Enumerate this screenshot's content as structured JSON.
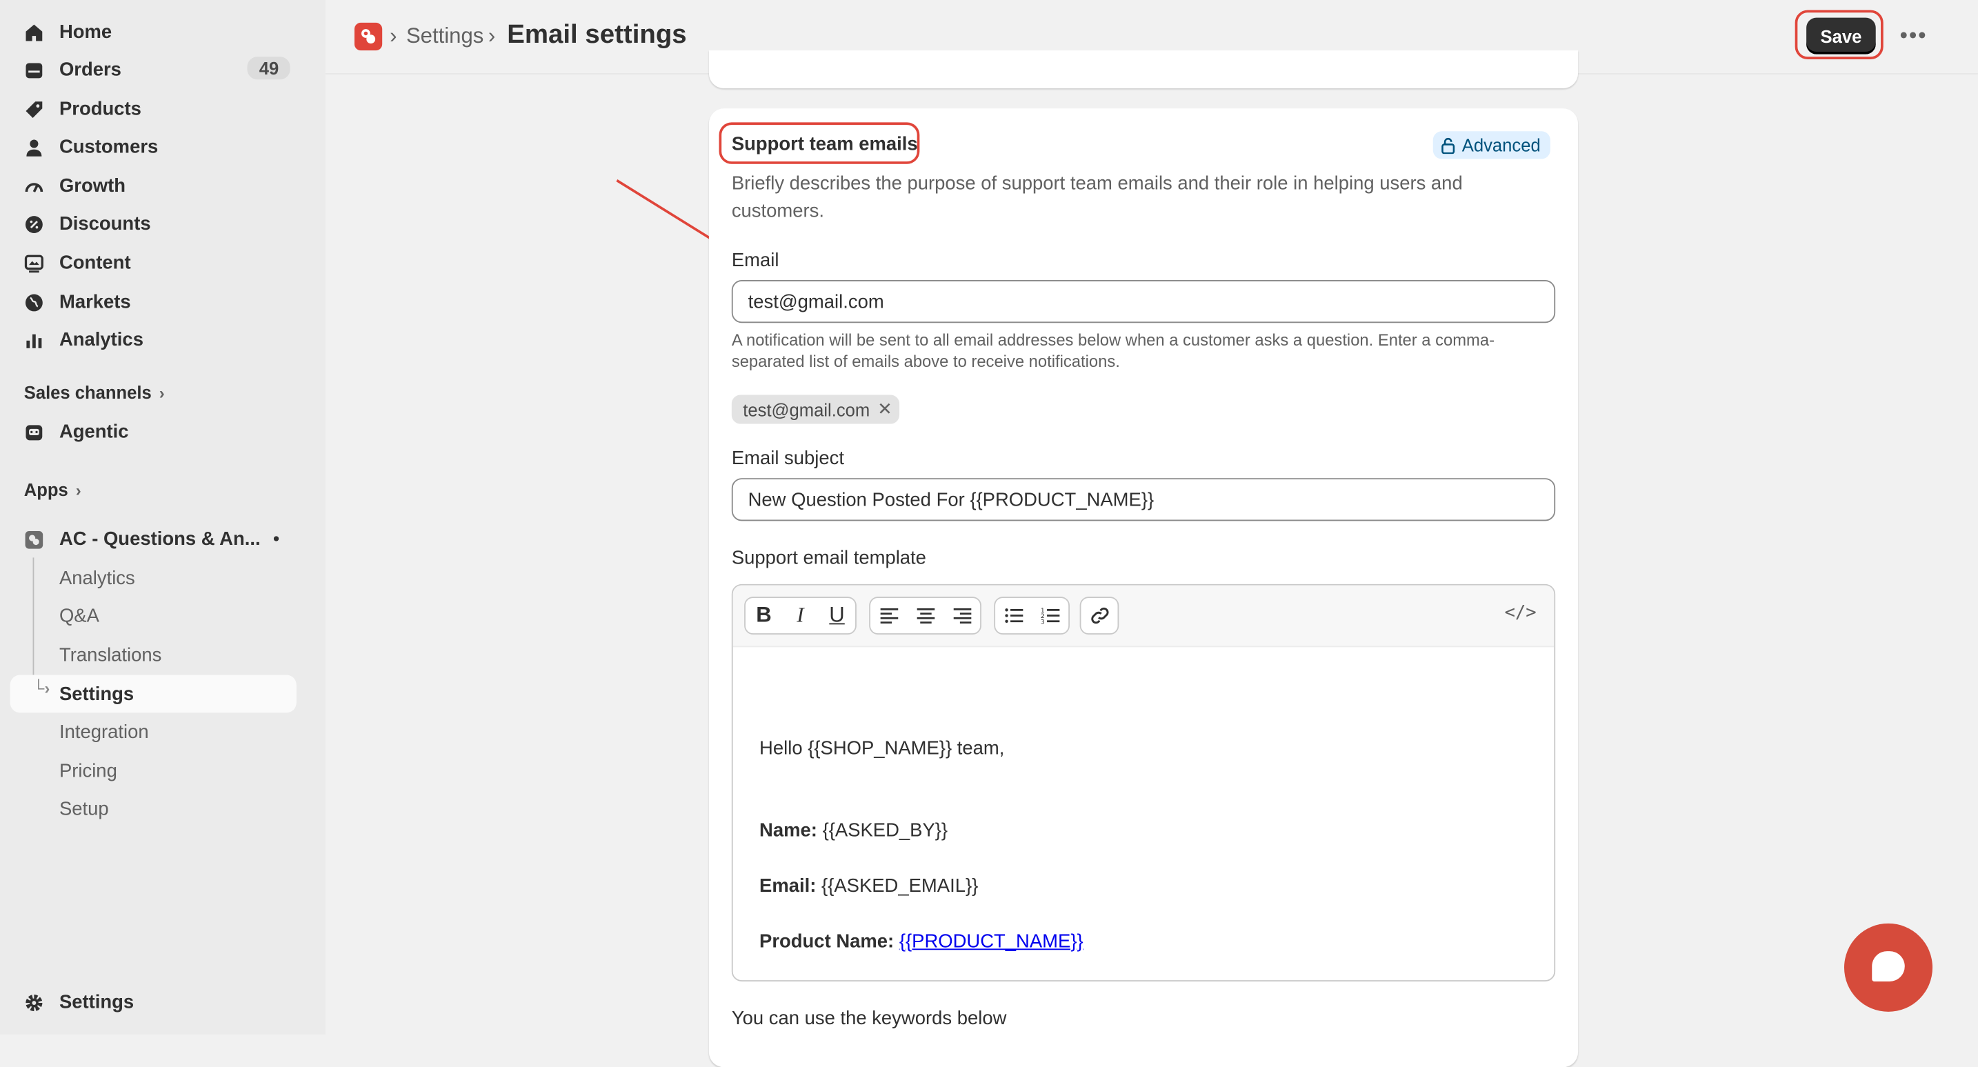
{
  "sidebar": {
    "items": [
      {
        "label": "Home",
        "icon": "home-icon"
      },
      {
        "label": "Orders",
        "icon": "orders-icon",
        "badge": "49"
      },
      {
        "label": "Products",
        "icon": "tag-icon"
      },
      {
        "label": "Customers",
        "icon": "person-icon"
      },
      {
        "label": "Growth",
        "icon": "growth-icon"
      },
      {
        "label": "Discounts",
        "icon": "discount-icon"
      },
      {
        "label": "Content",
        "icon": "content-icon"
      },
      {
        "label": "Markets",
        "icon": "globe-icon"
      },
      {
        "label": "Analytics",
        "icon": "bar-chart-icon"
      }
    ],
    "sales_channels": "Sales channels",
    "agentic": "Agentic",
    "apps": "Apps",
    "app_name": "AC - Questions & An...",
    "app_sub": [
      "Analytics",
      "Q&A",
      "Translations",
      "Settings",
      "Integration",
      "Pricing",
      "Setup"
    ],
    "settings": "Settings"
  },
  "header": {
    "crumb": "Settings",
    "title": "Email settings",
    "save": "Save",
    "more": "•••"
  },
  "card": {
    "title": "Support team emails",
    "badge": "Advanced",
    "description": "Briefly describes the purpose of support team emails and their role in helping users and customers.",
    "email_label": "Email",
    "email_value": "test@gmail.com",
    "email_help": "A notification will be sent to all email addresses below when a customer asks a question. Enter a comma-separated list of emails above to receive notifications.",
    "tag": "test@gmail.com",
    "subject_label": "Email subject",
    "subject_value": "New Question Posted For {{PRODUCT_NAME}}",
    "template_label": "Support email template",
    "template": {
      "greeting": "Hello {{SHOP_NAME}} team,",
      "name_label": "Name:",
      "name_value": "{{ASKED_BY}}",
      "email_label": "Email:",
      "email_value": "{{ASKED_EMAIL}}",
      "product_label": "Product Name:",
      "product_value": "{{PRODUCT_NAME}}"
    },
    "keywords_label": "You can use the keywords below"
  },
  "colors": {
    "accent_red": "#e0453a",
    "save_bg": "#303030",
    "badge_bg": "#e0f0ff"
  }
}
